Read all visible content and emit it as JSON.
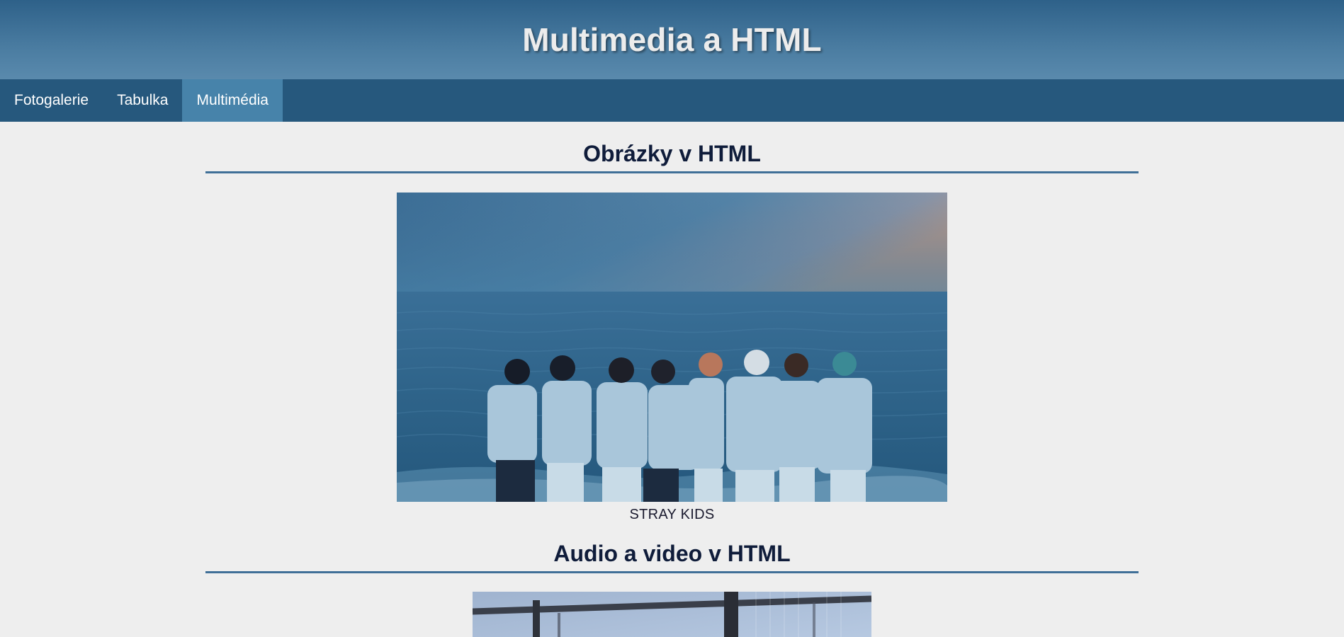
{
  "header": {
    "title": "Multimedia a HTML"
  },
  "nav": {
    "items": [
      {
        "label": "Fotogalerie",
        "active": false
      },
      {
        "label": "Tabulka",
        "active": false
      },
      {
        "label": "Multimédia",
        "active": true
      }
    ]
  },
  "sections": {
    "images": {
      "title": "Obrázky v HTML",
      "caption": "STRAY KIDS"
    },
    "media": {
      "title": "Audio a video v HTML"
    }
  },
  "colors": {
    "header_gradient_top": "#2e6189",
    "nav_background": "#26587d",
    "nav_active": "#4783aa",
    "page_background": "#eeeeee",
    "heading_text": "#0f1c3a",
    "heading_rule": "#3f6f97"
  }
}
